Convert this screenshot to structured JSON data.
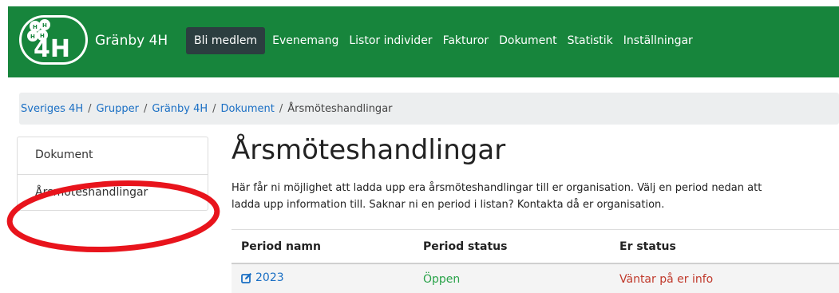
{
  "navbar": {
    "brand": "Gränby 4H",
    "logo_text": "4H",
    "items": [
      {
        "label": "Bli medlem",
        "active": true
      },
      {
        "label": "Evenemang"
      },
      {
        "label": "Listor individer"
      },
      {
        "label": "Fakturor"
      },
      {
        "label": "Dokument"
      },
      {
        "label": "Statistik"
      },
      {
        "label": "Inställningar"
      }
    ],
    "color": "#17853c"
  },
  "breadcrumb": {
    "items": [
      "Sveriges 4H",
      "Grupper",
      "Gränby 4H",
      "Dokument"
    ],
    "current": "Årsmöteshandlingar",
    "separator": "/"
  },
  "sidebar": {
    "items": [
      {
        "label": "Dokument"
      },
      {
        "label": "Årsmöteshandlingar"
      }
    ]
  },
  "main": {
    "title": "Årsmöteshandlingar",
    "description_line1": "Här får ni möjlighet att ladda upp era årsmöteshandlingar till er organisation. Välj en period nedan att",
    "description_line2": "ladda upp information till. Saknar ni en period i listan? Kontakta då er organisation.",
    "table": {
      "headers": [
        "Period namn",
        "Period status",
        "Er status"
      ],
      "rows": [
        {
          "period": "2023",
          "status": "Öppen",
          "er_status": "Väntar på er info"
        }
      ]
    }
  },
  "annotation": {
    "color": "#e8141c",
    "shape": "ellipse"
  }
}
